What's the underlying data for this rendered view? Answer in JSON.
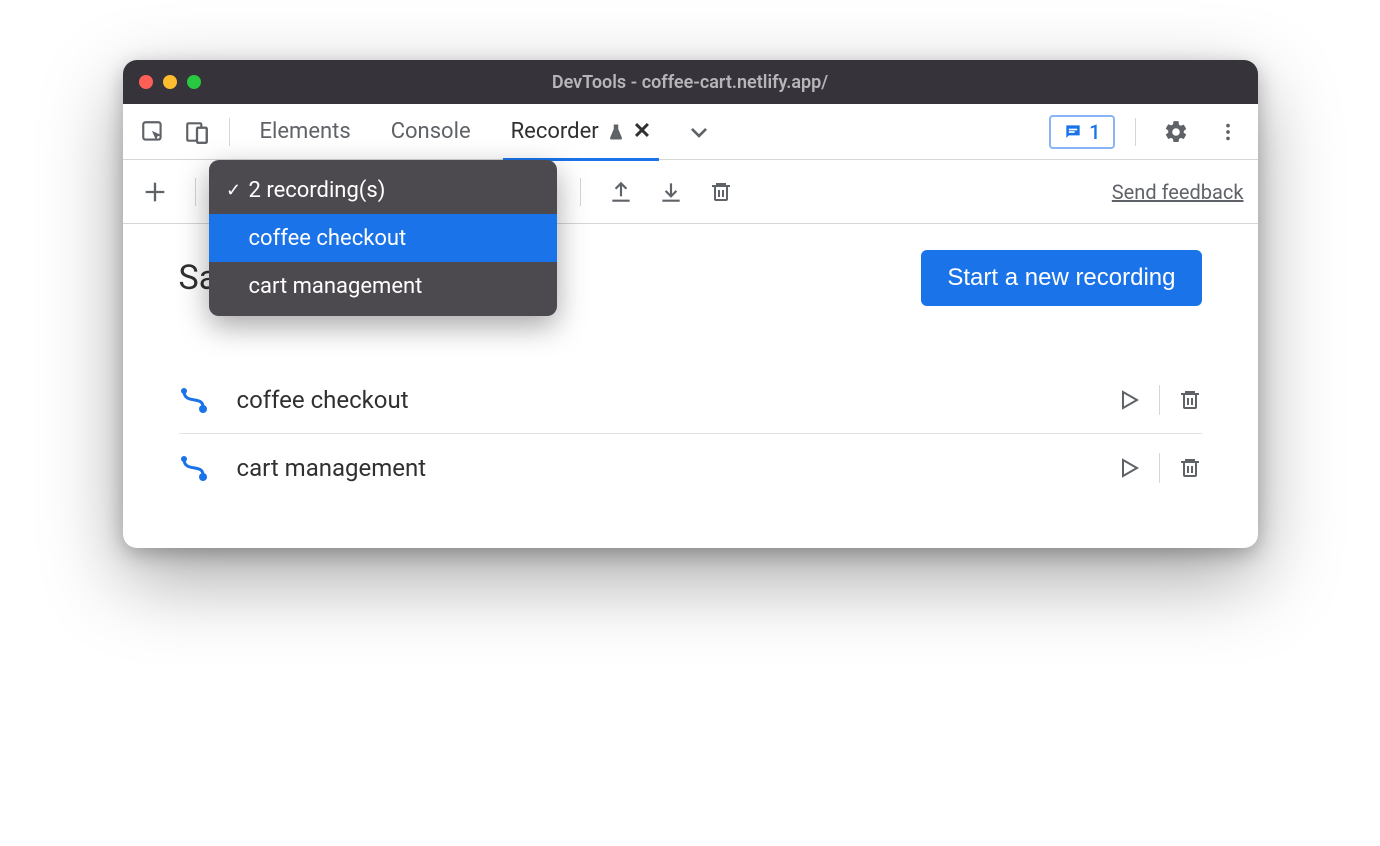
{
  "window": {
    "title": "DevTools - coffee-cart.netlify.app/"
  },
  "tabs": {
    "elements": "Elements",
    "console": "Console",
    "recorder": "Recorder"
  },
  "chat_count": "1",
  "recorder_toolbar": {
    "send_feedback": "Send feedback"
  },
  "dropdown": {
    "summary": "2 recording(s)",
    "items": [
      "coffee checkout",
      "cart management"
    ]
  },
  "page": {
    "title": "Saved recordings",
    "start_button": "Start a new recording"
  },
  "recordings": [
    {
      "name": "coffee checkout"
    },
    {
      "name": "cart management"
    }
  ]
}
